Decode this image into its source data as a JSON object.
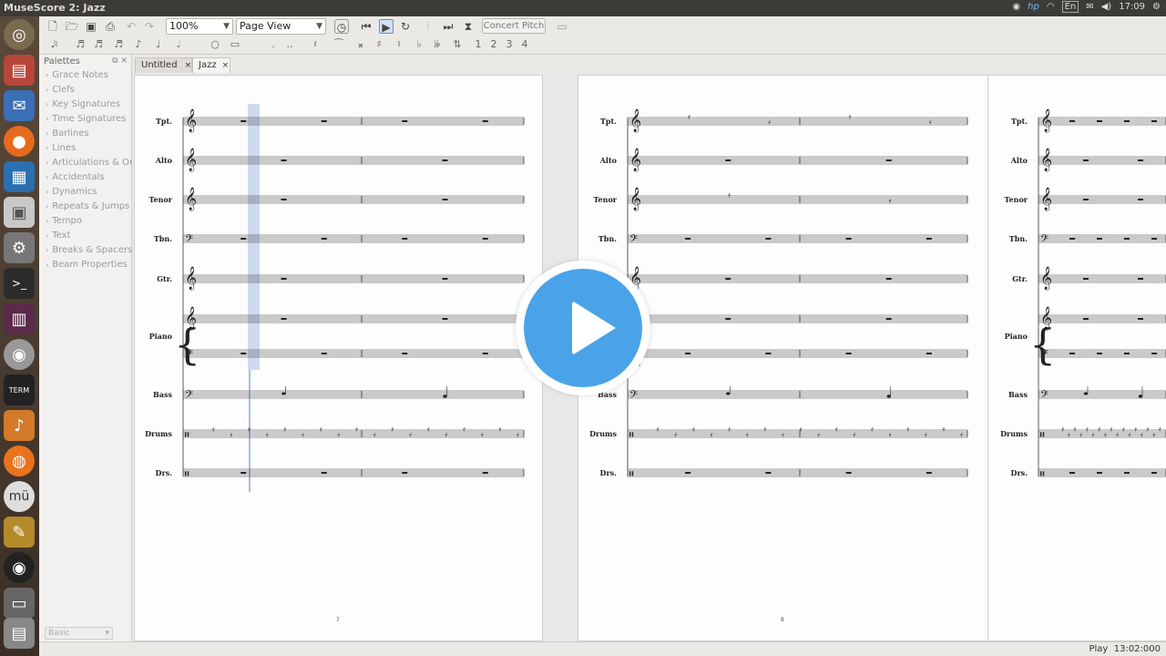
{
  "window": {
    "title": "MuseScore 2: Jazz"
  },
  "tray": {
    "lang": "En",
    "time": "17:09"
  },
  "toolbar": {
    "zoom": "100%",
    "view_mode": "Page View",
    "concert_pitch": "Concert Pitch"
  },
  "note_toolbar": {
    "voices": [
      "1",
      "2",
      "3",
      "4"
    ]
  },
  "palettes": {
    "header": "Palettes",
    "items": [
      "Grace Notes",
      "Clefs",
      "Key Signatures",
      "Time Signatures",
      "Barlines",
      "Lines",
      "Articulations & Or",
      "Accidentals",
      "Dynamics",
      "Repeats & Jumps",
      "Tempo",
      "Text",
      "Breaks & Spacers",
      "Beam Properties"
    ],
    "workspace": "Basic"
  },
  "tabs": [
    {
      "label": "Untitled",
      "close": "×"
    },
    {
      "label": "Jazz",
      "close": "×"
    }
  ],
  "score": {
    "instruments": [
      "Tpt.",
      "Alto",
      "Tenor",
      "Tbn.",
      "Gtr.",
      "Piano",
      "Bass",
      "Drums",
      "Drs."
    ],
    "page_numbers": [
      "7",
      "8"
    ]
  },
  "status": {
    "mode": "Play",
    "time": "13:02:000"
  },
  "colors": {
    "accent": "#4aa3e8",
    "selection": "#a8bde6"
  }
}
